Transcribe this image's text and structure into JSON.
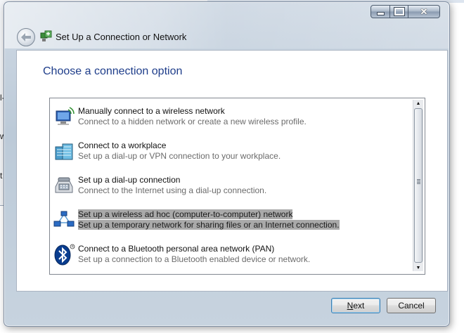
{
  "background_window": {
    "edge_fragments": [
      "l-",
      "w",
      "t"
    ]
  },
  "window": {
    "title": "Set Up a Connection or Network",
    "caption": {
      "minimize_icon": "minimize-icon",
      "maximize_icon": "maximize-icon",
      "close_glyph": "✕"
    },
    "back_icon": "back-arrow-icon",
    "title_icon": "network-setup-icon"
  },
  "main": {
    "heading": "Choose a connection option",
    "options": [
      {
        "title": "Manually connect to a wireless network",
        "desc": "Connect to a hidden network or create a new wireless profile.",
        "icon": "wireless-computer-icon",
        "selected": false
      },
      {
        "title": "Connect to a workplace",
        "desc": "Set up a dial-up or VPN connection to your workplace.",
        "icon": "workplace-building-icon",
        "selected": false
      },
      {
        "title": "Set up a dial-up connection",
        "desc": "Connect to the Internet using a dial-up connection.",
        "icon": "dialup-phone-icon",
        "selected": false
      },
      {
        "title": "Set up a wireless ad hoc (computer-to-computer) network",
        "desc": "Set up a temporary network for sharing files or an Internet connection.",
        "icon": "adhoc-network-icon",
        "selected": true
      },
      {
        "title": "Connect to a Bluetooth personal area network (PAN)",
        "desc": "Set up a connection to a Bluetooth enabled device or network.",
        "icon": "bluetooth-icon",
        "selected": false
      }
    ]
  },
  "footer": {
    "next_label": "Next",
    "next_mnemonic": "N",
    "next_rest": "ext",
    "cancel_label": "Cancel"
  },
  "colors": {
    "heading": "#1e3d8a",
    "selection": "#a9a9a9",
    "bluetooth": "#0a3d8f"
  }
}
